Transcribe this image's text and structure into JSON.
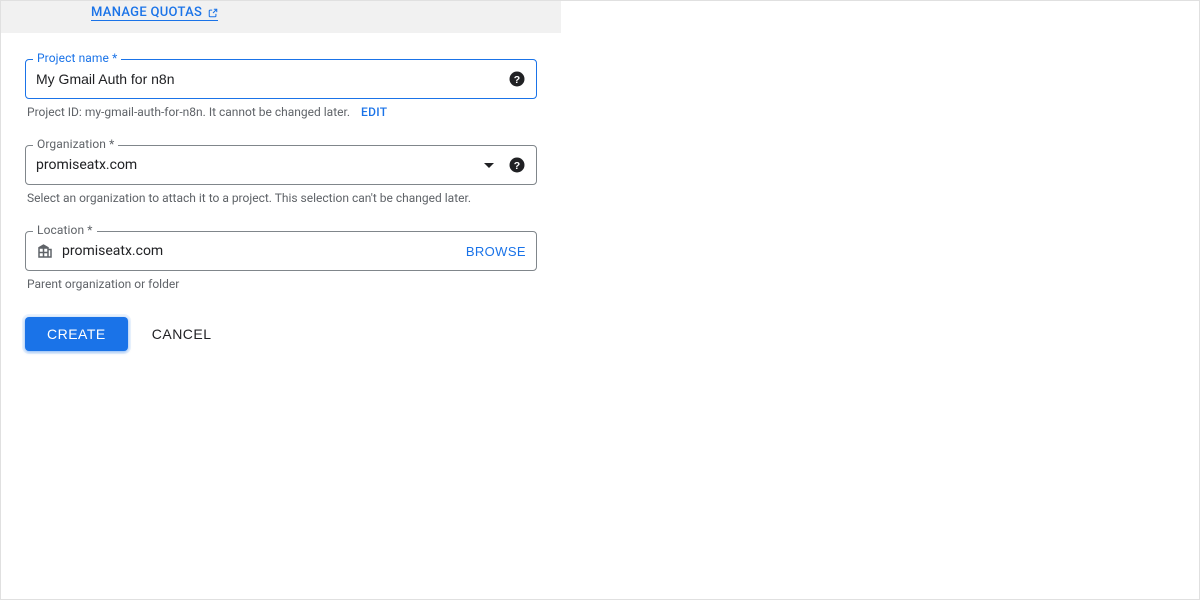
{
  "banner": {
    "manage_quotas_label": "MANAGE QUOTAS"
  },
  "project_name": {
    "label": "Project name *",
    "value": "My Gmail Auth for n8n"
  },
  "project_id_line": {
    "prefix": "Project ID: ",
    "id": "my-gmail-auth-for-n8n",
    "suffix": ". It cannot be changed later.",
    "edit_label": "EDIT"
  },
  "organization": {
    "label": "Organization *",
    "value": "promiseatx.com",
    "helper": "Select an organization to attach it to a project. This selection can't be changed later."
  },
  "location": {
    "label": "Location *",
    "value": "promiseatx.com",
    "browse_label": "BROWSE",
    "helper": "Parent organization or folder"
  },
  "buttons": {
    "create": "CREATE",
    "cancel": "CANCEL"
  }
}
